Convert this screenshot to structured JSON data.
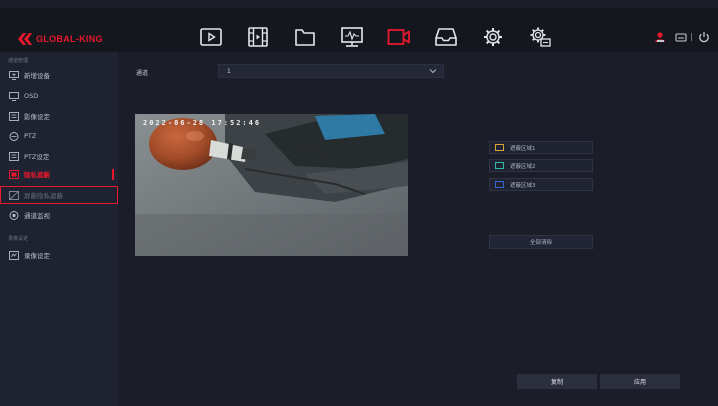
{
  "brand": {
    "name": "GLOBAL-KING",
    "accent": "#e8192c"
  },
  "topnav": [
    {
      "name": "playback-icon",
      "active": false
    },
    {
      "name": "film-icon",
      "active": false
    },
    {
      "name": "folder-icon",
      "active": false
    },
    {
      "name": "network-monitor-icon",
      "active": false
    },
    {
      "name": "camera-icon",
      "active": true
    },
    {
      "name": "storage-icon",
      "active": false
    },
    {
      "name": "settings-gear-icon",
      "active": false
    },
    {
      "name": "system-settings-icon",
      "active": false
    }
  ],
  "status_icons": [
    "alarm-user-icon",
    "hdd-icon",
    "power-icon"
  ],
  "sidebar": {
    "section1": "通道管理",
    "items": [
      {
        "label": "新增设备",
        "icon": "add-device-icon"
      },
      {
        "label": "OSD",
        "icon": "osd-monitor-icon"
      },
      {
        "label": "影像设定",
        "icon": "image-settings-icon"
      },
      {
        "label": "PTZ",
        "icon": "ptz-icon"
      },
      {
        "label": "PTZ设定",
        "icon": "ptz-settings-icon"
      },
      {
        "label": "隐私遮蔽",
        "icon": "privacy-mask-icon"
      },
      {
        "label": "屏蔽隐私遮蔽",
        "icon": "privacy-disabled-icon"
      },
      {
        "label": "通道监视",
        "icon": "channel-view-icon"
      }
    ],
    "section2": "录像设定",
    "items2": [
      {
        "label": "录像设定",
        "icon": "record-settings-icon"
      }
    ]
  },
  "main": {
    "channel_label": "通道",
    "channel_value": "1",
    "osd_timestamp": "2022-06-28 17:52:46",
    "zones": [
      {
        "label": "遮蔽区域1",
        "color": "#d9a537"
      },
      {
        "label": "遮蔽区域2",
        "color": "#2fb7a8"
      },
      {
        "label": "遮蔽区域3",
        "color": "#3a66d4"
      }
    ],
    "clear_all": "全部清除",
    "copy": "复制",
    "apply": "应用"
  }
}
